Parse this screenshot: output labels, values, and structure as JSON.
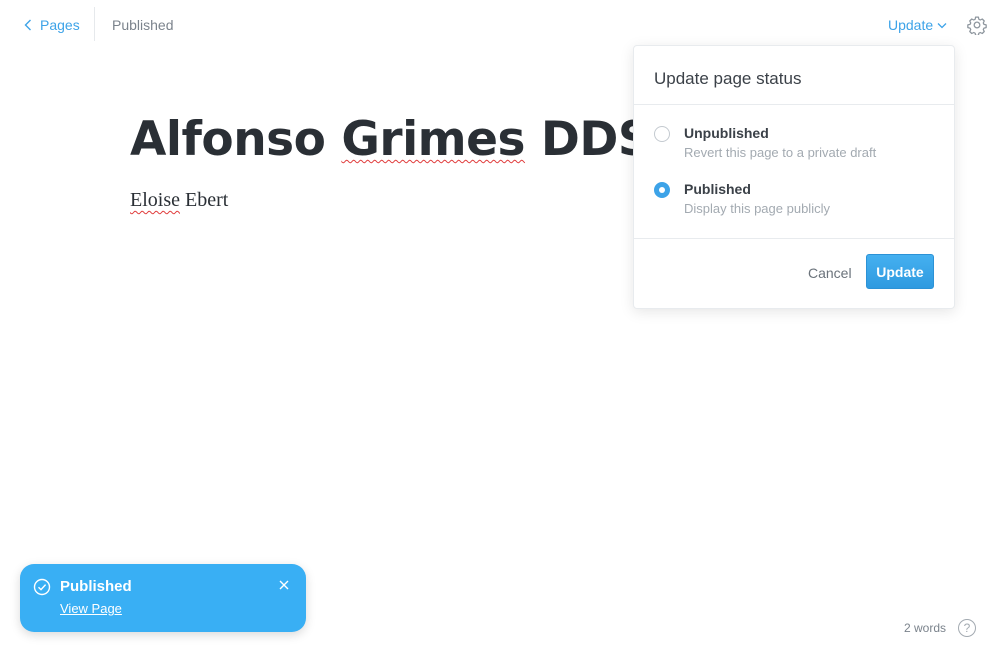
{
  "topbar": {
    "back_label": "Pages",
    "status_label": "Published",
    "update_label": "Update"
  },
  "document": {
    "title_parts": [
      "Alfonso ",
      "Grimes",
      " DDS"
    ],
    "body_parts": [
      "Eloise",
      " Ebert"
    ]
  },
  "popover": {
    "title": "Update page status",
    "options": [
      {
        "title": "Unpublished",
        "description": "Revert this page to a private draft",
        "selected": false
      },
      {
        "title": "Published",
        "description": "Display this page publicly",
        "selected": true
      }
    ],
    "cancel_label": "Cancel",
    "update_label": "Update"
  },
  "toast": {
    "title": "Published",
    "link_label": "View Page"
  },
  "footer": {
    "word_count": "2 words",
    "help_label": "?"
  },
  "colors": {
    "accent": "#3da3e8",
    "toast_bg": "#39aff4",
    "text": "#2a2f35"
  },
  "icons": [
    "chevron-left-icon",
    "chevron-down-icon",
    "gear-icon",
    "check-circle-icon",
    "close-icon",
    "help-icon"
  ]
}
